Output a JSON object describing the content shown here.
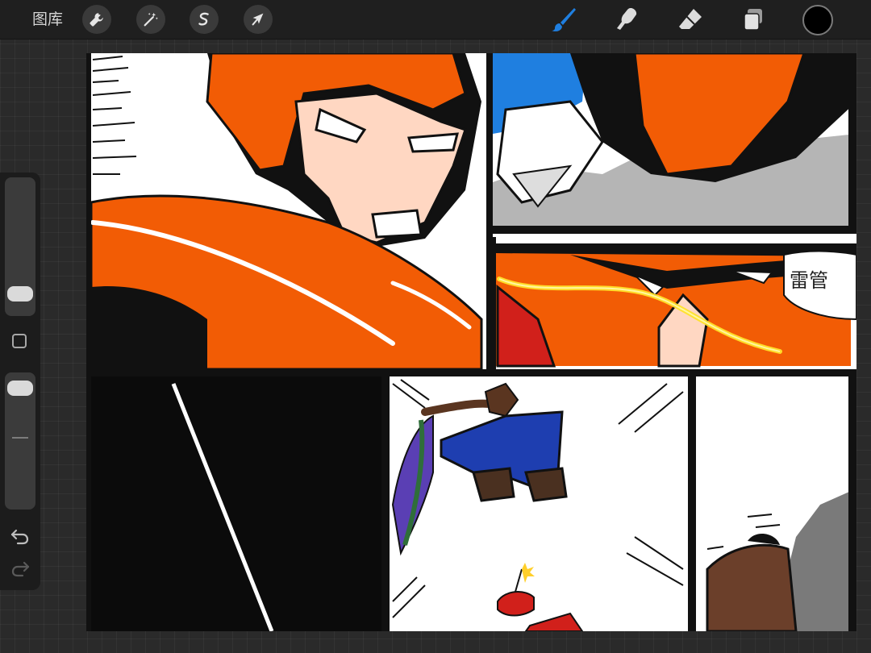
{
  "app": {
    "gallery_label": "图库"
  },
  "toolbar_left": [
    {
      "name": "actions",
      "icon": "wrench-icon"
    },
    {
      "name": "adjustments",
      "icon": "magic-wand-icon"
    },
    {
      "name": "selection",
      "icon": "selection-s-icon"
    },
    {
      "name": "transform",
      "icon": "arrow-cursor-icon"
    }
  ],
  "toolbar_right": [
    {
      "name": "brush",
      "icon": "brush-icon",
      "active": true
    },
    {
      "name": "smudge",
      "icon": "smudge-finger-icon",
      "active": false
    },
    {
      "name": "eraser",
      "icon": "eraser-icon",
      "active": false
    },
    {
      "name": "layers",
      "icon": "layers-icon",
      "active": false
    }
  ],
  "colors": {
    "current_color": "#000000",
    "accent": "#1f7fe0",
    "toolbar_bg": "#1f1f1f",
    "canvas_bg": "#ffffff",
    "orange": "#f25c05",
    "lightning": "#ffe12a"
  },
  "sidebar": {
    "brush_size_level": 0.1,
    "opacity_level": 0.95,
    "undo_icon": "undo-arrow-icon",
    "redo_icon": "redo-arrow-icon",
    "modify_icon": "square-modify-icon"
  },
  "artwork": {
    "sfx_text": "雷管"
  }
}
